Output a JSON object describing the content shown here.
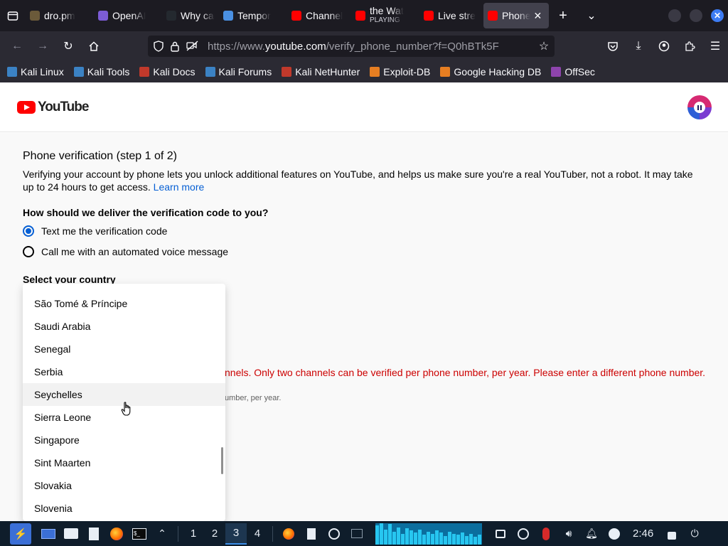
{
  "browser": {
    "tabs": [
      {
        "title": "dro.pm",
        "favicon": "folder-icon",
        "color": "#6b5a3a"
      },
      {
        "title": "OpenAI",
        "favicon": "openai-icon",
        "color": "#7c5cd6"
      },
      {
        "title": "Why can",
        "favicon": "github-icon",
        "color": "#24292f"
      },
      {
        "title": "Tempor",
        "favicon": "phone-icon",
        "color": "#4a90e2"
      },
      {
        "title": "Channel",
        "favicon": "youtube-icon",
        "color": "#ff0000"
      },
      {
        "title": "the Wat",
        "subtitle": "PLAYING",
        "favicon": "youtube-icon",
        "color": "#ff0000"
      },
      {
        "title": "Live stre",
        "favicon": "youtube-icon",
        "color": "#ff0000"
      },
      {
        "title": "Phone",
        "favicon": "youtube-icon",
        "color": "#ff0000",
        "active": true
      }
    ],
    "url_prefix": "https://www.",
    "url_domain": "youtube.com",
    "url_rest": "/verify_phone_number?f=Q0hBTk5F",
    "bookmarks": [
      {
        "label": "Kali Linux",
        "color": "#3b82c4"
      },
      {
        "label": "Kali Tools",
        "color": "#3b82c4"
      },
      {
        "label": "Kali Docs",
        "color": "#c0392b"
      },
      {
        "label": "Kali Forums",
        "color": "#3b82c4"
      },
      {
        "label": "Kali NetHunter",
        "color": "#c0392b"
      },
      {
        "label": "Exploit-DB",
        "color": "#e67e22"
      },
      {
        "label": "Google Hacking DB",
        "color": "#e67e22"
      },
      {
        "label": "OffSec",
        "color": "#8e44ad"
      }
    ]
  },
  "page": {
    "logo_text": "YouTube",
    "title": "Phone verification (step 1 of 2)",
    "description": "Verifying your account by phone lets you unlock additional features on YouTube, and helps us make sure you're a real YouTuber, not a robot. It may take up to 24 hours to get access.",
    "learn_more": "Learn more",
    "delivery_question": "How should we deliver the verification code to you?",
    "option_text": "Text me the verification code",
    "option_call": "Call me with an automated voice message",
    "country_label": "Select your country",
    "error_visible": "nnels. Only two channels can be verified per phone number, per year. Please enter a different phone number.",
    "hint_visible": "umber, per year.",
    "country_options": [
      "São Tomé & Príncipe",
      "Saudi Arabia",
      "Senegal",
      "Serbia",
      "Seychelles",
      "Sierra Leone",
      "Singapore",
      "Sint Maarten",
      "Slovakia",
      "Slovenia"
    ],
    "hovered_option": "Seychelles"
  },
  "taskbar": {
    "workspaces": [
      "1",
      "2",
      "3",
      "4"
    ],
    "active_workspace": "3",
    "clock": "2:46"
  }
}
